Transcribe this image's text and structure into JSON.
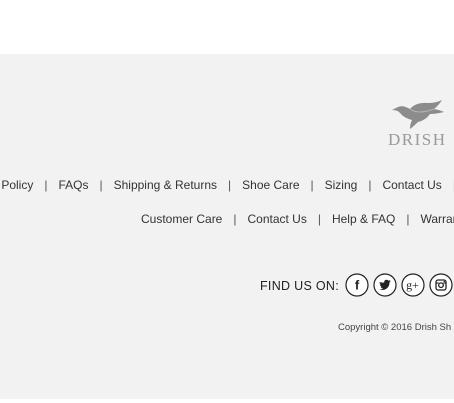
{
  "brand": {
    "logo_text": "DRISH",
    "logo_icon": "bird-logo-icon"
  },
  "footer": {
    "nav_primary": [
      "y Policy",
      "FAQs",
      "Shipping & Returns",
      "Shoe Care",
      "Sizing",
      "Contact Us"
    ],
    "nav_secondary": [
      "Customer Care",
      "Contact Us",
      "Help & FAQ",
      "Warrant"
    ],
    "separator": "|",
    "find_us_label": "FIND US ON:",
    "social": [
      {
        "name": "facebook",
        "icon": "facebook-icon",
        "glyph": "f"
      },
      {
        "name": "twitter",
        "icon": "twitter-icon"
      },
      {
        "name": "google-plus",
        "icon": "google-plus-icon",
        "glyph": "g+"
      },
      {
        "name": "instagram",
        "icon": "instagram-icon"
      }
    ],
    "copyright": "Copyright © 2016 Drish Sh"
  },
  "colors": {
    "footer_bg": "#f2f2f2",
    "text": "#333333",
    "logo_gray": "#9a9a9a"
  }
}
